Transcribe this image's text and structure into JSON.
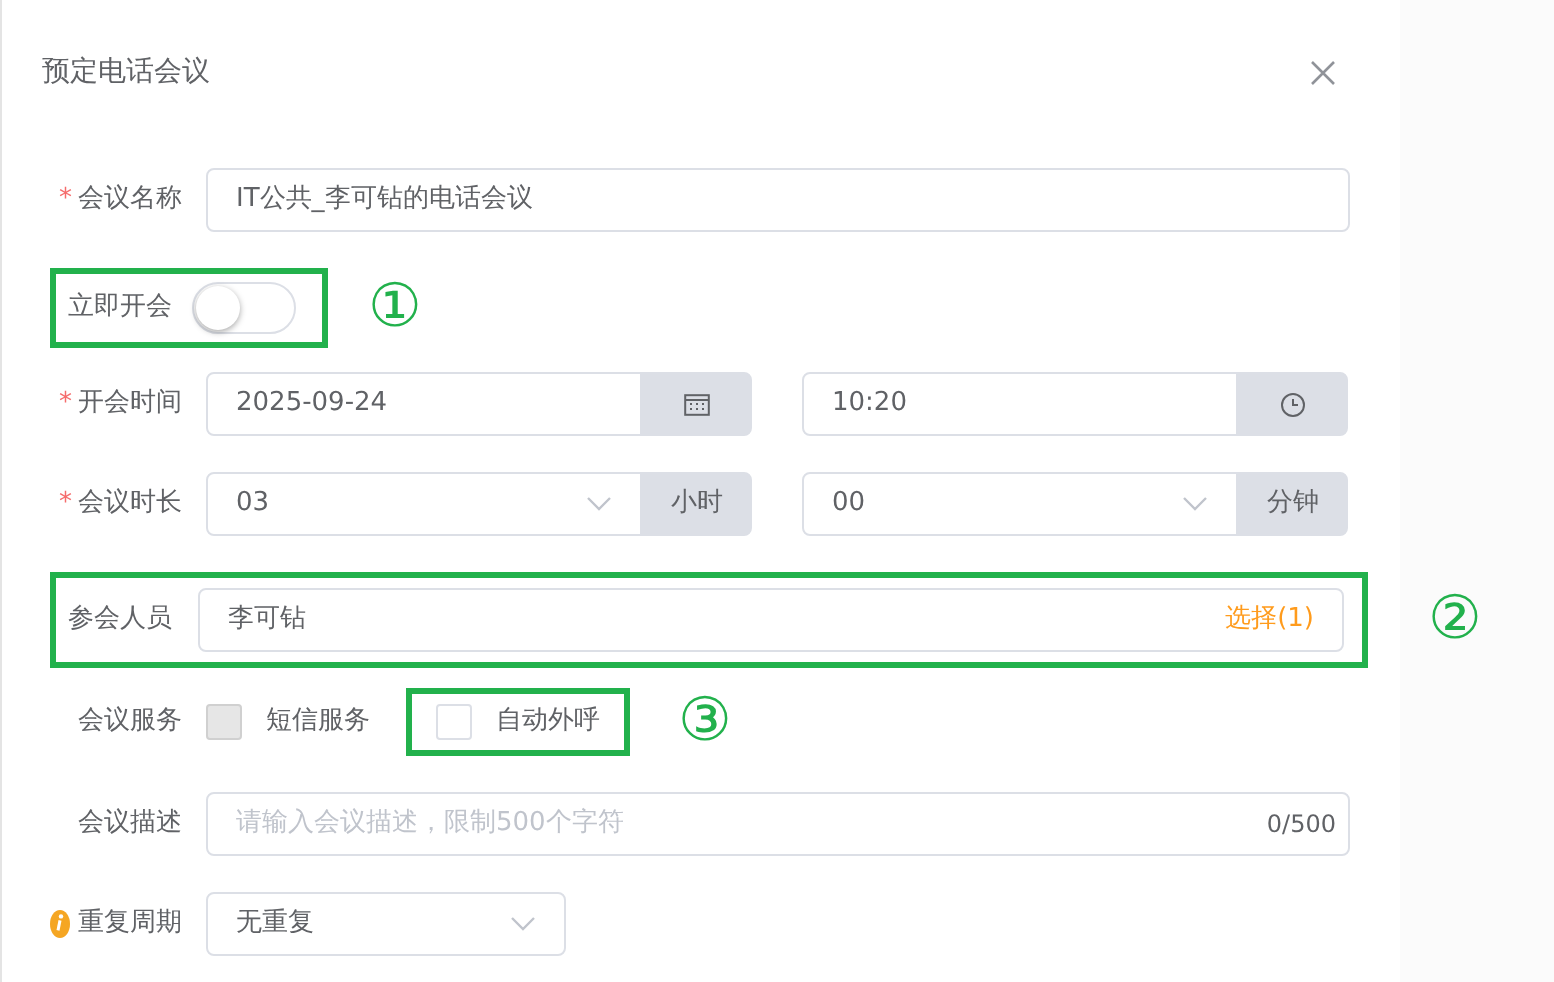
{
  "dialog": {
    "title": "预定电话会议"
  },
  "fields": [
    {
      "kind": "text",
      "label": "会议名称",
      "required_mark": "*",
      "info": false,
      "highlight": false,
      "value": "IT公共_李可钻的电话会议"
    },
    {
      "kind": "switch",
      "label": "立即开会",
      "info": false,
      "highlight": true,
      "callout": "①",
      "on": false
    },
    {
      "kind": "datetime",
      "label": "开会时间",
      "required_mark": "*",
      "info": false,
      "highlight": false,
      "date": "2025-09-24",
      "time": "10:20"
    },
    {
      "kind": "duration",
      "label": "会议时长",
      "required_mark": "*",
      "info": false,
      "highlight": false,
      "hours": "03",
      "hours_unit": "小时",
      "minutes": "00",
      "minutes_unit": "分钟"
    },
    {
      "kind": "members",
      "label": "参会人员",
      "info": false,
      "highlight": true,
      "callout": "②",
      "value": "李可钻",
      "action": "选择(1)"
    },
    {
      "kind": "checks",
      "label": "会议服务",
      "info": false,
      "highlight": false,
      "options": [
        {
          "label": "短信服务",
          "checked": false,
          "disabled": true,
          "highlight": false
        },
        {
          "label": "自动外呼",
          "checked": false,
          "disabled": false,
          "highlight": true,
          "callout": "③"
        }
      ]
    },
    {
      "kind": "textarea",
      "label": "会议描述",
      "info": false,
      "highlight": false,
      "placeholder": "请输入会议描述，限制500个字符",
      "counter": "0/500"
    },
    {
      "kind": "select",
      "label": "重复周期",
      "info": true,
      "highlight": false,
      "value": "无重复"
    }
  ]
}
